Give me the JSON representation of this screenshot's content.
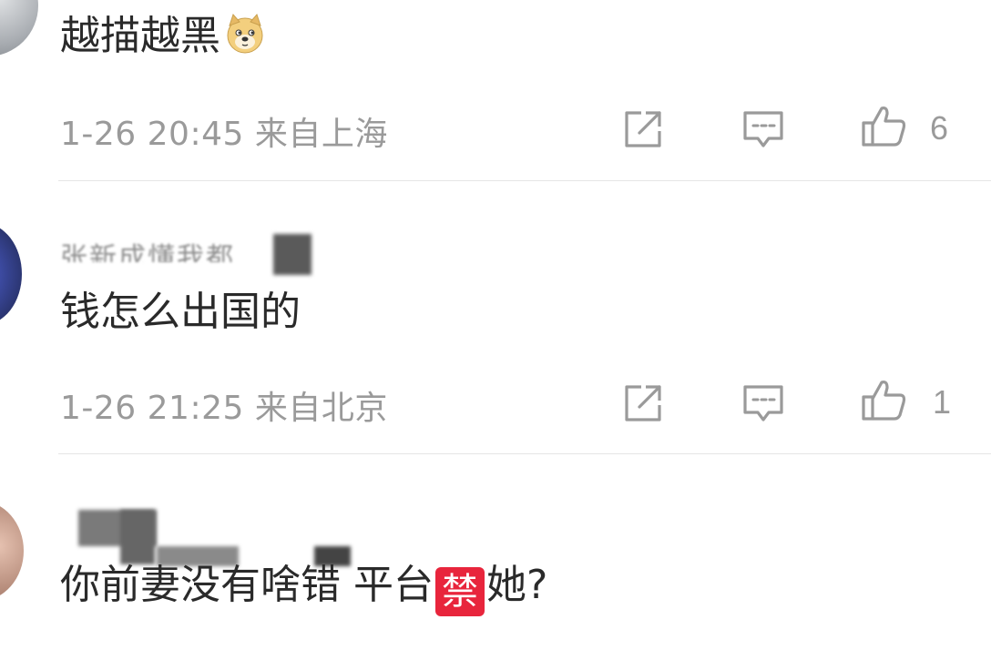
{
  "comments": [
    {
      "username": "",
      "text": "越描越黑",
      "emoji": "doge-emoji",
      "time": "1-26 20:45",
      "location": "来自上海",
      "like_count": "6"
    },
    {
      "username": "张新成懂我都",
      "text": "钱怎么出国的",
      "time": "1-26 21:25",
      "location": "来自北京",
      "like_count": "1"
    },
    {
      "username": "",
      "text_before": "你前妻没有啥错 平台",
      "emoji_ban": "禁",
      "text_after": "她?"
    }
  ],
  "icons": {
    "share": "share-icon",
    "reply": "comment-icon",
    "like": "thumbs-up-icon"
  },
  "colors": {
    "text": "#2a2a2a",
    "meta": "#9a9a9a",
    "ban_emoji_bg": "#e8253c"
  }
}
